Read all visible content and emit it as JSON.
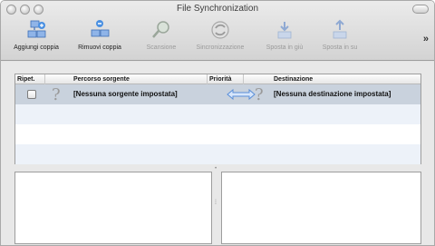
{
  "window": {
    "title": "File Synchronization"
  },
  "toolbar": {
    "items": [
      {
        "label": "Aggiungi coppia",
        "icon": "add-pair-icon",
        "enabled": true
      },
      {
        "label": "Rimuovi coppia",
        "icon": "remove-pair-icon",
        "enabled": true
      },
      {
        "label": "Scansione",
        "icon": "scan-icon",
        "enabled": false
      },
      {
        "label": "Sincronizzazione",
        "icon": "sync-icon",
        "enabled": false
      },
      {
        "label": "Sposta in giù",
        "icon": "move-down-icon",
        "enabled": false
      },
      {
        "label": "Sposta in su",
        "icon": "move-up-icon",
        "enabled": false
      }
    ],
    "overflow": "»"
  },
  "table": {
    "columns": [
      "Ripet.",
      "Percorso sorgente",
      "Priorità",
      "Destinazione"
    ],
    "rows": [
      {
        "repeat": false,
        "source_status": "?",
        "source": "[Nessuna sorgente impostata]",
        "priority_icon": "bidirectional-arrow-icon",
        "destination_status": "?",
        "destination": "[Nessuna destinazione impostata]"
      }
    ]
  },
  "colors": {
    "selection": "#c9d2dd",
    "alt_row": "#edf2f9",
    "arrow": "#6f9bd6"
  }
}
